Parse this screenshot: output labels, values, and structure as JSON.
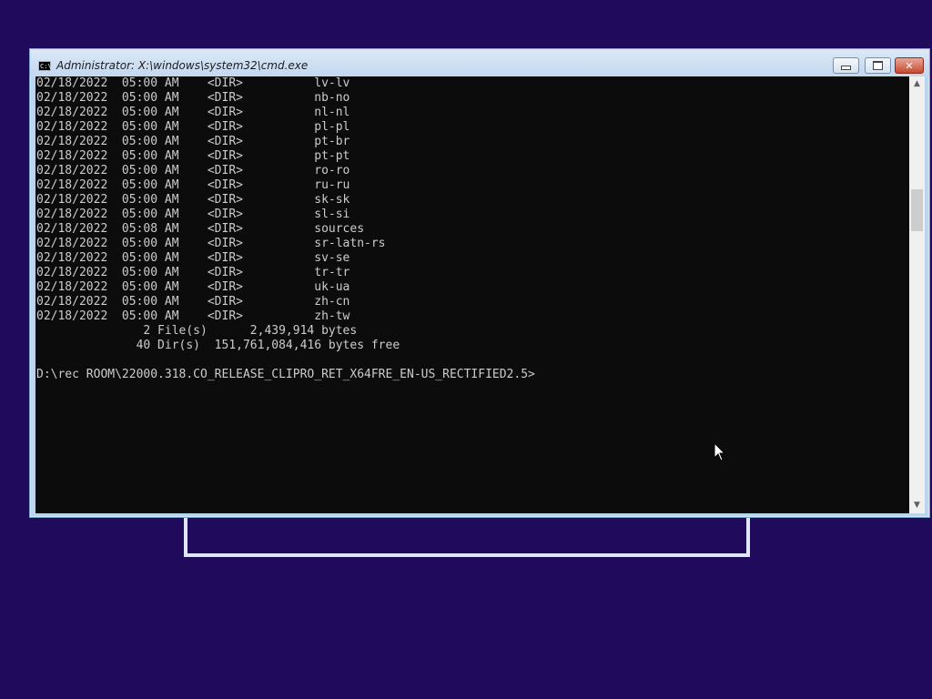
{
  "colors": {
    "desktop_background": "#1f0a5c",
    "console_background": "#0c0c0c",
    "console_text": "#cccccc",
    "close_button": "#c74a2e"
  },
  "window": {
    "title": "Administrator: X:\\windows\\system32\\cmd.exe",
    "icon": "cmd-icon",
    "controls": {
      "minimize": "minimize-icon",
      "maximize": "maximize-icon",
      "close": "✕"
    }
  },
  "console": {
    "lines": [
      "02/18/2022  05:00 AM    <DIR>          lv-lv",
      "02/18/2022  05:00 AM    <DIR>          nb-no",
      "02/18/2022  05:00 AM    <DIR>          nl-nl",
      "02/18/2022  05:00 AM    <DIR>          pl-pl",
      "02/18/2022  05:00 AM    <DIR>          pt-br",
      "02/18/2022  05:00 AM    <DIR>          pt-pt",
      "02/18/2022  05:00 AM    <DIR>          ro-ro",
      "02/18/2022  05:00 AM    <DIR>          ru-ru",
      "02/18/2022  05:00 AM    <DIR>          sk-sk",
      "02/18/2022  05:00 AM    <DIR>          sl-si",
      "02/18/2022  05:08 AM    <DIR>          sources",
      "02/18/2022  05:00 AM    <DIR>          sr-latn-rs",
      "02/18/2022  05:00 AM    <DIR>          sv-se",
      "02/18/2022  05:00 AM    <DIR>          tr-tr",
      "02/18/2022  05:00 AM    <DIR>          uk-ua",
      "02/18/2022  05:00 AM    <DIR>          zh-cn",
      "02/18/2022  05:00 AM    <DIR>          zh-tw",
      "               2 File(s)      2,439,914 bytes",
      "              40 Dir(s)  151,761,084,416 bytes free",
      "",
      "D:\\rec ROOM\\22000.318.CO_RELEASE_CLIPRO_RET_X64FRE_EN-US_RECTIFIED2.5>"
    ]
  },
  "scrollbar": {
    "up_arrow": "▲",
    "down_arrow": "▼"
  }
}
